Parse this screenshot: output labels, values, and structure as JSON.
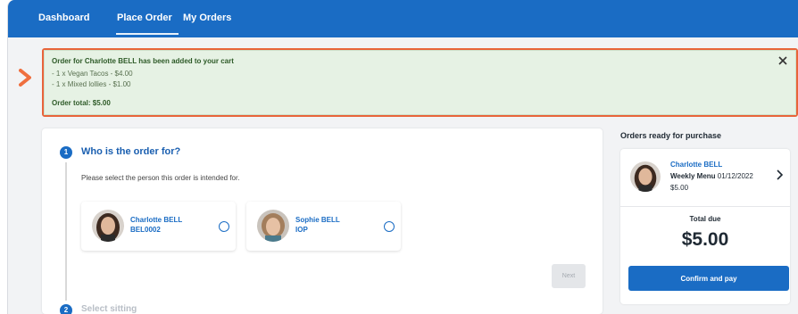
{
  "nav": {
    "items": [
      {
        "label": "Dashboard"
      },
      {
        "label": "Place Order"
      },
      {
        "label": "My Orders"
      }
    ],
    "active": "Place Order"
  },
  "alert": {
    "title": "Order for Charlotte BELL has been added to your cart",
    "lines": [
      "- 1 x Vegan Tacos - $4.00",
      "- 1 x Mixed lollies - $1.00"
    ],
    "total": "Order total: $5.00",
    "close_icon": "close-icon",
    "color": "#e8643a"
  },
  "steps": {
    "step1": {
      "number": "1",
      "title": "Who is the order for?",
      "subtitle": "Please select the person this order is intended for.",
      "people": [
        {
          "name": "Charlotte BELL",
          "id": "BEL0002"
        },
        {
          "name": "Sophie BELL",
          "id": "IOP"
        }
      ],
      "next_label": "Next"
    },
    "step2": {
      "number": "2",
      "title": "Select sitting"
    }
  },
  "sidebar": {
    "heading": "Orders ready for purchase",
    "order": {
      "name": "Charlotte BELL",
      "menu": "Weekly Menu",
      "date": "01/12/2022",
      "price": "$5.00"
    },
    "total_label": "Total due",
    "total_value": "$5.00",
    "pay_label": "Confirm and pay"
  },
  "colors": {
    "brand": "#1a6cc4",
    "alert_bg": "#e6f2e4",
    "alert_border": "#e8643a"
  }
}
